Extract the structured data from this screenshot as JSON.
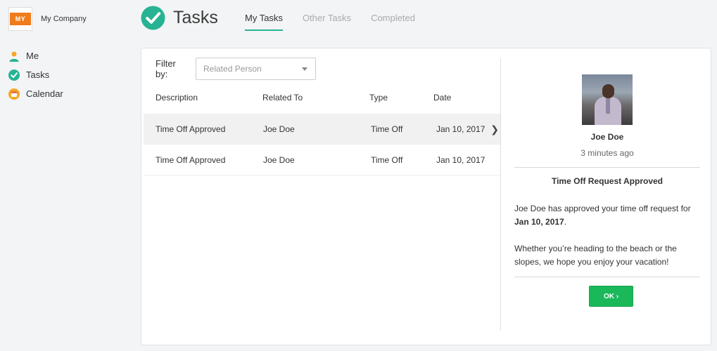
{
  "company": {
    "logo_text": "MY",
    "name": "My Company",
    "logo_color": "#f07c1c"
  },
  "nav": {
    "items": [
      {
        "label": "Me",
        "icon": "person-icon"
      },
      {
        "label": "Tasks",
        "icon": "check-circle-icon"
      },
      {
        "label": "Calendar",
        "icon": "calendar-icon"
      }
    ]
  },
  "header": {
    "title": "Tasks",
    "accent": "#27b393",
    "tabs": [
      {
        "label": "My Tasks",
        "active": true
      },
      {
        "label": "Other Tasks",
        "active": false
      },
      {
        "label": "Completed",
        "active": false
      }
    ]
  },
  "filter": {
    "label": "Filter by:",
    "placeholder": "Related Person"
  },
  "table": {
    "columns": [
      "Description",
      "Related To",
      "Type",
      "Date"
    ],
    "rows": [
      {
        "description": "Time Off Approved",
        "related_to": "Joe Doe",
        "type": "Time Off",
        "date": "Jan 10, 2017",
        "selected": true
      },
      {
        "description": "Time Off Approved",
        "related_to": "Joe Doe",
        "type": "Time Off",
        "date": "Jan 10, 2017",
        "selected": false
      }
    ],
    "row_arrow": "❯"
  },
  "detail": {
    "name": "Joe Doe",
    "time_ago": "3 minutes ago",
    "request_title": "Time Off Request Approved",
    "message_prefix": "Joe Doe has approved your time off request for ",
    "message_date": "Jan 10, 2017",
    "message_suffix": ".",
    "message2": "Whether you’re heading to the beach or the slopes, we hope you enjoy your vacation!",
    "ok_label": "OK ›",
    "ok_color": "#1bb85a"
  }
}
